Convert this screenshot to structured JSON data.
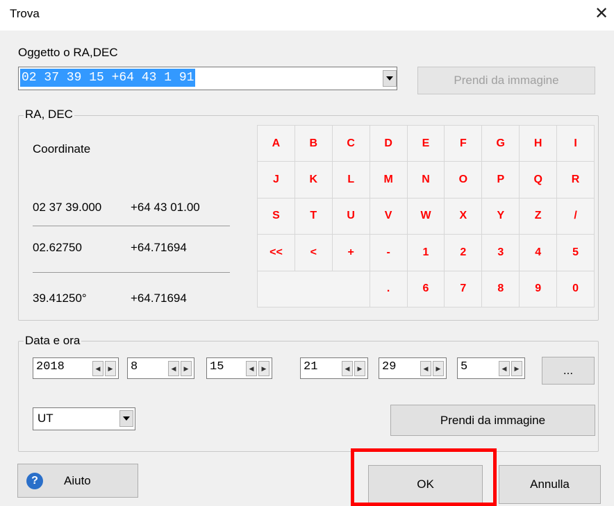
{
  "window": {
    "title": "Trova"
  },
  "object": {
    "label": "Oggetto o RA,DEC",
    "value": "02 37 39 15 +64 43 1 91",
    "grab_button": "Prendi da immagine"
  },
  "radec": {
    "group_title": "RA, DEC",
    "coord_label": "Coordinate",
    "rows": [
      {
        "ra": "02 37 39.000",
        "dec": "+64 43 01.00"
      },
      {
        "ra": "02.62750",
        "dec": "+64.71694"
      },
      {
        "ra": "39.41250°",
        "dec": "+64.71694"
      }
    ],
    "keys": [
      "A",
      "B",
      "C",
      "D",
      "E",
      "F",
      "G",
      "H",
      "I",
      "J",
      "K",
      "L",
      "M",
      "N",
      "O",
      "P",
      "Q",
      "R",
      "S",
      "T",
      "U",
      "V",
      "W",
      "X",
      "Y",
      "Z",
      "/",
      "<<",
      "<",
      "+",
      "-",
      "1",
      "2",
      "3",
      "4",
      "5",
      "",
      ".",
      "6",
      "7",
      "8",
      "9",
      "0"
    ]
  },
  "datetime": {
    "group_title": "Data e ora",
    "fields": [
      "2018",
      "8",
      "15",
      "21",
      "29",
      "5"
    ],
    "more_button": "...",
    "timezone": "UT",
    "grab_button": "Prendi da immagine"
  },
  "footer": {
    "help": "Aiuto",
    "ok": "OK",
    "cancel": "Annulla"
  },
  "icons": {
    "close": "close-icon",
    "help": "help-icon",
    "dropdown": "chevron-down-icon"
  },
  "colors": {
    "key_text": "#ff0000",
    "selection": "#3399ff",
    "highlight": "#ff0000"
  }
}
